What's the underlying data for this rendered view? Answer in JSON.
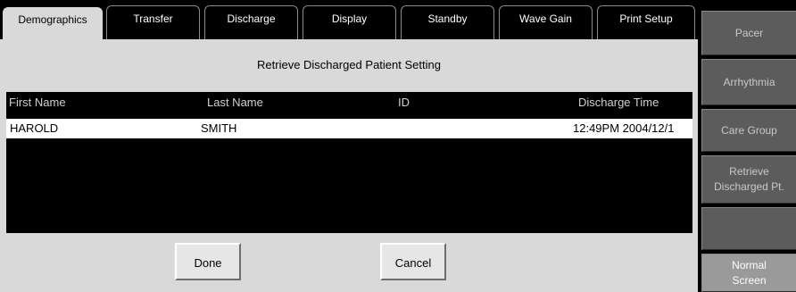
{
  "tabs": [
    {
      "label": "Demographics",
      "active": true
    },
    {
      "label": "Transfer",
      "active": false
    },
    {
      "label": "Discharge",
      "active": false
    },
    {
      "label": "Display",
      "active": false
    },
    {
      "label": "Standby",
      "active": false
    },
    {
      "label": "Wave Gain",
      "active": false
    },
    {
      "label": "Print Setup",
      "active": false
    }
  ],
  "panel": {
    "title": "Retrieve Discharged Patient Setting",
    "columns": {
      "first_name": "First Name",
      "last_name": "Last Name",
      "id": "ID",
      "discharge_time": "Discharge Time"
    },
    "rows": [
      {
        "first_name": "HAROLD",
        "last_name": "SMITH",
        "id": "",
        "discharge_time": "12:49PM 2004/12/1",
        "selected": true
      }
    ],
    "buttons": {
      "done": "Done",
      "cancel": "Cancel"
    }
  },
  "sidebar": {
    "items": [
      {
        "label": "Pacer"
      },
      {
        "label": "Arrhythmia"
      },
      {
        "label": "Care Group"
      },
      {
        "label": "Retrieve Discharged Pt."
      },
      {
        "label": ""
      },
      {
        "label": "Normal Screen"
      }
    ]
  },
  "colors": {
    "background": "#000000",
    "panel": "#d9d9d9",
    "sidebar_button": "#5c5c5c",
    "normal_screen_button": "#9a9a9a",
    "selected_row": "#ffffff"
  }
}
